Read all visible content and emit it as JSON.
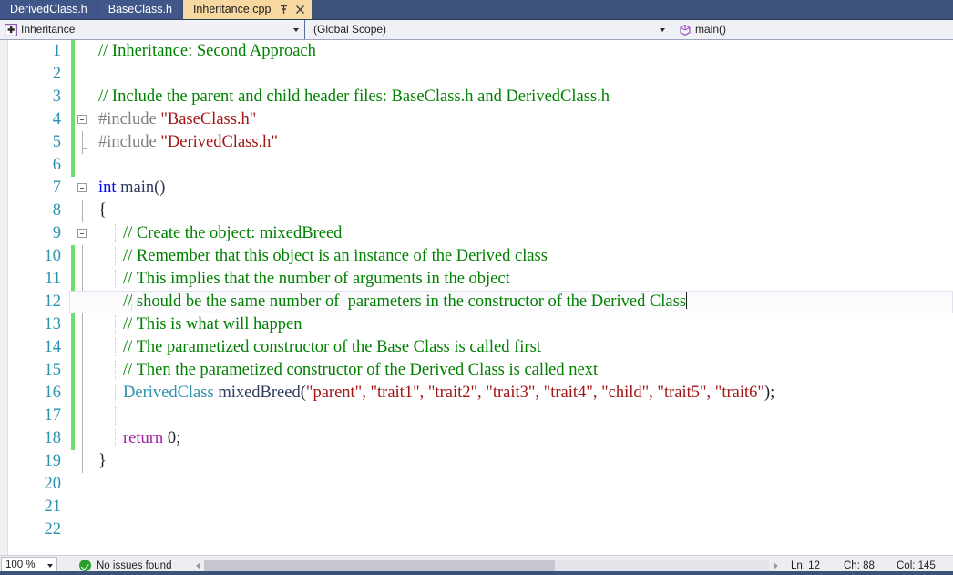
{
  "tabs": [
    {
      "label": "DerivedClass.h",
      "active": false
    },
    {
      "label": "BaseClass.h",
      "active": false
    },
    {
      "label": "Inheritance.cpp",
      "active": true
    }
  ],
  "tab_icons": {
    "pin": "pin-icon",
    "close": "close-icon"
  },
  "navbar": {
    "project": {
      "icon": "project-icon",
      "label": "Inheritance"
    },
    "scope": {
      "label": "(Global Scope)"
    },
    "member": {
      "icon": "method-icon",
      "label": "main()"
    }
  },
  "editor": {
    "lines": [
      {
        "n": "1",
        "text": "  // Inheritance: Second Approach"
      },
      {
        "n": "2",
        "text": ""
      },
      {
        "n": "3",
        "text": "  // Include the parent and child header files: BaseClass.h and DerivedClass.h"
      },
      {
        "n": "4",
        "text": "#include \"BaseClass.h\""
      },
      {
        "n": "5",
        "text": " #include \"DerivedClass.h\""
      },
      {
        "n": "6",
        "text": ""
      },
      {
        "n": "7",
        "text": "int main()"
      },
      {
        "n": "8",
        "text": " {"
      },
      {
        "n": "9",
        "text": "    // Create the object: mixedBreed"
      },
      {
        "n": "10",
        "text": "    // Remember that this object is an instance of the Derived class"
      },
      {
        "n": "11",
        "text": "    // This implies that the number of arguments in the object"
      },
      {
        "n": "12",
        "text": "    // should be the same number of  parameters in the constructor of the Derived Class"
      },
      {
        "n": "13",
        "text": "    // This is what will happen"
      },
      {
        "n": "14",
        "text": "    // The parametized constructor of the Base Class is called first"
      },
      {
        "n": "15",
        "text": "    // Then the parametized constructor of the Derived Class is called next"
      },
      {
        "n": "16",
        "text": "    DerivedClass mixedBreed(\"parent\", \"trait1\", \"trait2\", \"trait3\", \"trait4\", \"child\", \"trait5\", \"trait6\");"
      },
      {
        "n": "17",
        "text": ""
      },
      {
        "n": "18",
        "text": "    return 0;"
      },
      {
        "n": "19",
        "text": " }"
      },
      {
        "n": "20",
        "text": ""
      },
      {
        "n": "21",
        "text": ""
      },
      {
        "n": "22",
        "text": ""
      }
    ],
    "tokens": {
      "l1_comment": "// Inheritance: Second Approach",
      "l3_comment": "// Include the parent and child header files: BaseClass.h and DerivedClass.h",
      "l4_preproc": "#include ",
      "l4_string": "\"BaseClass.h\"",
      "l5_preproc": "#include ",
      "l5_string": "\"DerivedClass.h\"",
      "l7_keyword": "int",
      "l7_name": " main()",
      "l8_brace": "{",
      "l9_comment": "// Create the object: mixedBreed",
      "l10_comment": "// Remember that this object is an instance of the Derived class",
      "l11_comment": "// This implies that the number of arguments in the object",
      "l12_comment": "// should be the same number of  parameters in the constructor of the Derived Class",
      "l13_comment": "// This is what will happen",
      "l14_comment": "// The parametized constructor of the Base Class is called first",
      "l15_comment": "// Then the parametized constructor of the Derived Class is called next",
      "l16_type": "DerivedClass",
      "l16_ident": " mixedBreed",
      "l16_open": "(",
      "l16_args": "\"parent\", \"trait1\", \"trait2\", \"trait3\", \"trait4\", \"child\", \"trait5\", \"trait6\"",
      "l16_close": ");",
      "l18_ctrl": "return",
      "l18_rest": " 0;",
      "l19_brace": "}"
    },
    "current_line": "12",
    "syntax_colors": {
      "comment": "#008000",
      "string": "#a31515",
      "keyword": "#0000ff",
      "control": "#a020a0",
      "type": "#2b91af",
      "preprocessor": "#808080",
      "line_number": "#2b91af",
      "change_bar": "#6fdd6f"
    }
  },
  "statusbar": {
    "zoom": "100 %",
    "issues_icon": "check-circle-icon",
    "issues": "No issues found",
    "line": "Ln: 12",
    "char": "Ch: 88",
    "col": "Col: 145"
  },
  "theme": {
    "tabbar_bg": "#3d5278",
    "tab_inactive_bg": "#41578a",
    "tab_active_bg": "#f7d8a0",
    "navbar_bg": "#eff1f6",
    "statusbar_bg": "#eeeef2"
  }
}
